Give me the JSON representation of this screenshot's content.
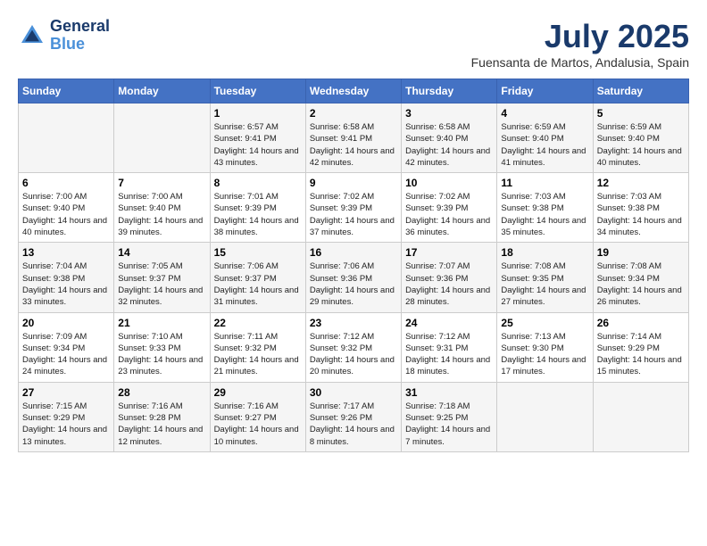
{
  "header": {
    "logo_line1": "General",
    "logo_line2": "Blue",
    "month": "July 2025",
    "location": "Fuensanta de Martos, Andalusia, Spain"
  },
  "weekdays": [
    "Sunday",
    "Monday",
    "Tuesday",
    "Wednesday",
    "Thursday",
    "Friday",
    "Saturday"
  ],
  "weeks": [
    [
      {
        "num": "",
        "info": ""
      },
      {
        "num": "",
        "info": ""
      },
      {
        "num": "1",
        "info": "Sunrise: 6:57 AM\nSunset: 9:41 PM\nDaylight: 14 hours and 43 minutes."
      },
      {
        "num": "2",
        "info": "Sunrise: 6:58 AM\nSunset: 9:41 PM\nDaylight: 14 hours and 42 minutes."
      },
      {
        "num": "3",
        "info": "Sunrise: 6:58 AM\nSunset: 9:40 PM\nDaylight: 14 hours and 42 minutes."
      },
      {
        "num": "4",
        "info": "Sunrise: 6:59 AM\nSunset: 9:40 PM\nDaylight: 14 hours and 41 minutes."
      },
      {
        "num": "5",
        "info": "Sunrise: 6:59 AM\nSunset: 9:40 PM\nDaylight: 14 hours and 40 minutes."
      }
    ],
    [
      {
        "num": "6",
        "info": "Sunrise: 7:00 AM\nSunset: 9:40 PM\nDaylight: 14 hours and 40 minutes."
      },
      {
        "num": "7",
        "info": "Sunrise: 7:00 AM\nSunset: 9:40 PM\nDaylight: 14 hours and 39 minutes."
      },
      {
        "num": "8",
        "info": "Sunrise: 7:01 AM\nSunset: 9:39 PM\nDaylight: 14 hours and 38 minutes."
      },
      {
        "num": "9",
        "info": "Sunrise: 7:02 AM\nSunset: 9:39 PM\nDaylight: 14 hours and 37 minutes."
      },
      {
        "num": "10",
        "info": "Sunrise: 7:02 AM\nSunset: 9:39 PM\nDaylight: 14 hours and 36 minutes."
      },
      {
        "num": "11",
        "info": "Sunrise: 7:03 AM\nSunset: 9:38 PM\nDaylight: 14 hours and 35 minutes."
      },
      {
        "num": "12",
        "info": "Sunrise: 7:03 AM\nSunset: 9:38 PM\nDaylight: 14 hours and 34 minutes."
      }
    ],
    [
      {
        "num": "13",
        "info": "Sunrise: 7:04 AM\nSunset: 9:38 PM\nDaylight: 14 hours and 33 minutes."
      },
      {
        "num": "14",
        "info": "Sunrise: 7:05 AM\nSunset: 9:37 PM\nDaylight: 14 hours and 32 minutes."
      },
      {
        "num": "15",
        "info": "Sunrise: 7:06 AM\nSunset: 9:37 PM\nDaylight: 14 hours and 31 minutes."
      },
      {
        "num": "16",
        "info": "Sunrise: 7:06 AM\nSunset: 9:36 PM\nDaylight: 14 hours and 29 minutes."
      },
      {
        "num": "17",
        "info": "Sunrise: 7:07 AM\nSunset: 9:36 PM\nDaylight: 14 hours and 28 minutes."
      },
      {
        "num": "18",
        "info": "Sunrise: 7:08 AM\nSunset: 9:35 PM\nDaylight: 14 hours and 27 minutes."
      },
      {
        "num": "19",
        "info": "Sunrise: 7:08 AM\nSunset: 9:34 PM\nDaylight: 14 hours and 26 minutes."
      }
    ],
    [
      {
        "num": "20",
        "info": "Sunrise: 7:09 AM\nSunset: 9:34 PM\nDaylight: 14 hours and 24 minutes."
      },
      {
        "num": "21",
        "info": "Sunrise: 7:10 AM\nSunset: 9:33 PM\nDaylight: 14 hours and 23 minutes."
      },
      {
        "num": "22",
        "info": "Sunrise: 7:11 AM\nSunset: 9:32 PM\nDaylight: 14 hours and 21 minutes."
      },
      {
        "num": "23",
        "info": "Sunrise: 7:12 AM\nSunset: 9:32 PM\nDaylight: 14 hours and 20 minutes."
      },
      {
        "num": "24",
        "info": "Sunrise: 7:12 AM\nSunset: 9:31 PM\nDaylight: 14 hours and 18 minutes."
      },
      {
        "num": "25",
        "info": "Sunrise: 7:13 AM\nSunset: 9:30 PM\nDaylight: 14 hours and 17 minutes."
      },
      {
        "num": "26",
        "info": "Sunrise: 7:14 AM\nSunset: 9:29 PM\nDaylight: 14 hours and 15 minutes."
      }
    ],
    [
      {
        "num": "27",
        "info": "Sunrise: 7:15 AM\nSunset: 9:29 PM\nDaylight: 14 hours and 13 minutes."
      },
      {
        "num": "28",
        "info": "Sunrise: 7:16 AM\nSunset: 9:28 PM\nDaylight: 14 hours and 12 minutes."
      },
      {
        "num": "29",
        "info": "Sunrise: 7:16 AM\nSunset: 9:27 PM\nDaylight: 14 hours and 10 minutes."
      },
      {
        "num": "30",
        "info": "Sunrise: 7:17 AM\nSunset: 9:26 PM\nDaylight: 14 hours and 8 minutes."
      },
      {
        "num": "31",
        "info": "Sunrise: 7:18 AM\nSunset: 9:25 PM\nDaylight: 14 hours and 7 minutes."
      },
      {
        "num": "",
        "info": ""
      },
      {
        "num": "",
        "info": ""
      }
    ]
  ]
}
